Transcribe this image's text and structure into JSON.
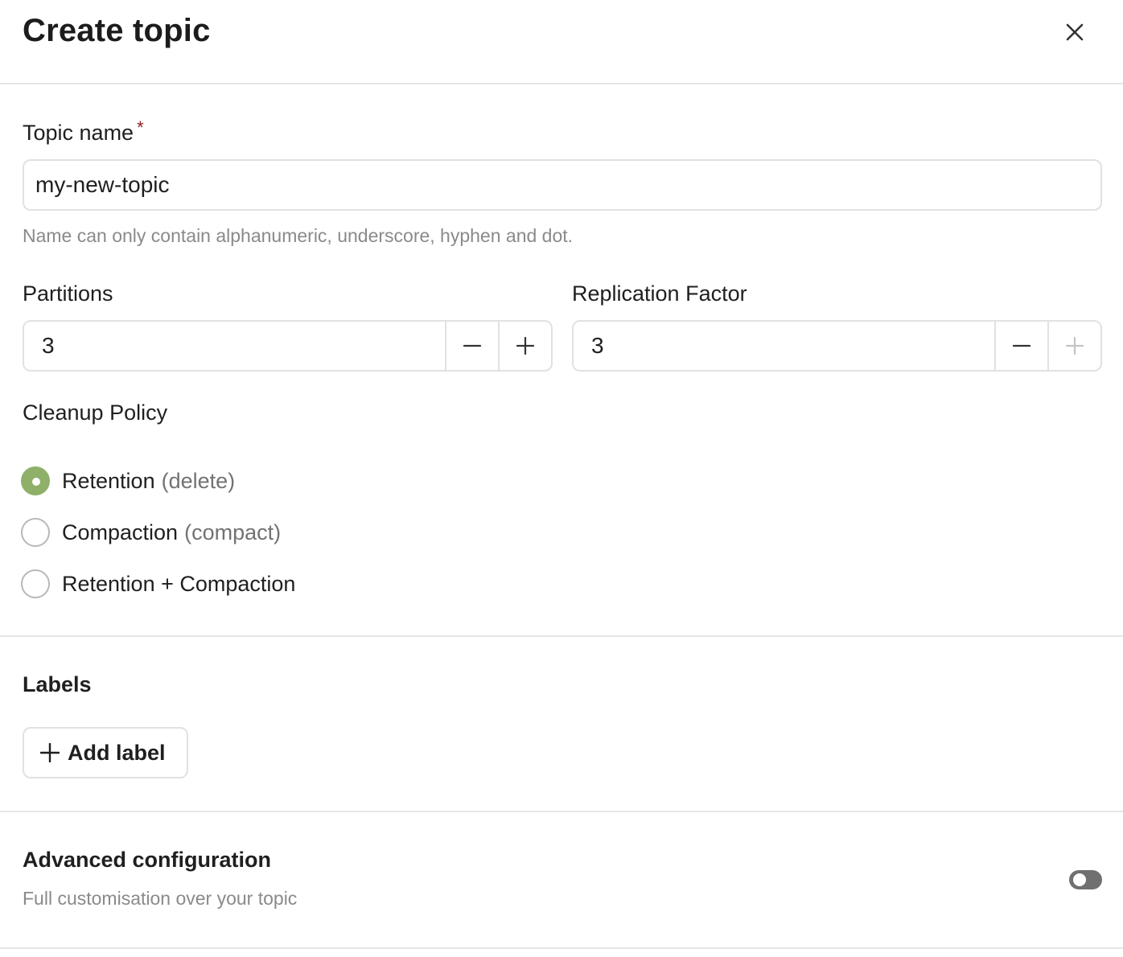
{
  "dialog": {
    "title": "Create topic",
    "close_icon": "close-icon"
  },
  "topic_name": {
    "label": "Topic name",
    "required_marker": "*",
    "value": "my-new-topic",
    "hint": "Name can only contain alphanumeric, underscore, hyphen and dot."
  },
  "partitions": {
    "label": "Partitions",
    "value": "3"
  },
  "replication_factor": {
    "label": "Replication Factor",
    "value": "3"
  },
  "cleanup_policy": {
    "label": "Cleanup Policy",
    "options": [
      {
        "label": "Retention",
        "sub": "(delete)",
        "selected": true
      },
      {
        "label": "Compaction",
        "sub": "(compact)",
        "selected": false
      },
      {
        "label": "Retention + Compaction",
        "sub": "",
        "selected": false
      }
    ]
  },
  "labels": {
    "title": "Labels",
    "add_button": "Add label"
  },
  "advanced": {
    "title": "Advanced configuration",
    "description": "Full customisation over your topic",
    "enabled": false
  },
  "colors": {
    "accent": "#8eb068",
    "required": "#8a1d1d",
    "toggle_off": "#707070"
  }
}
